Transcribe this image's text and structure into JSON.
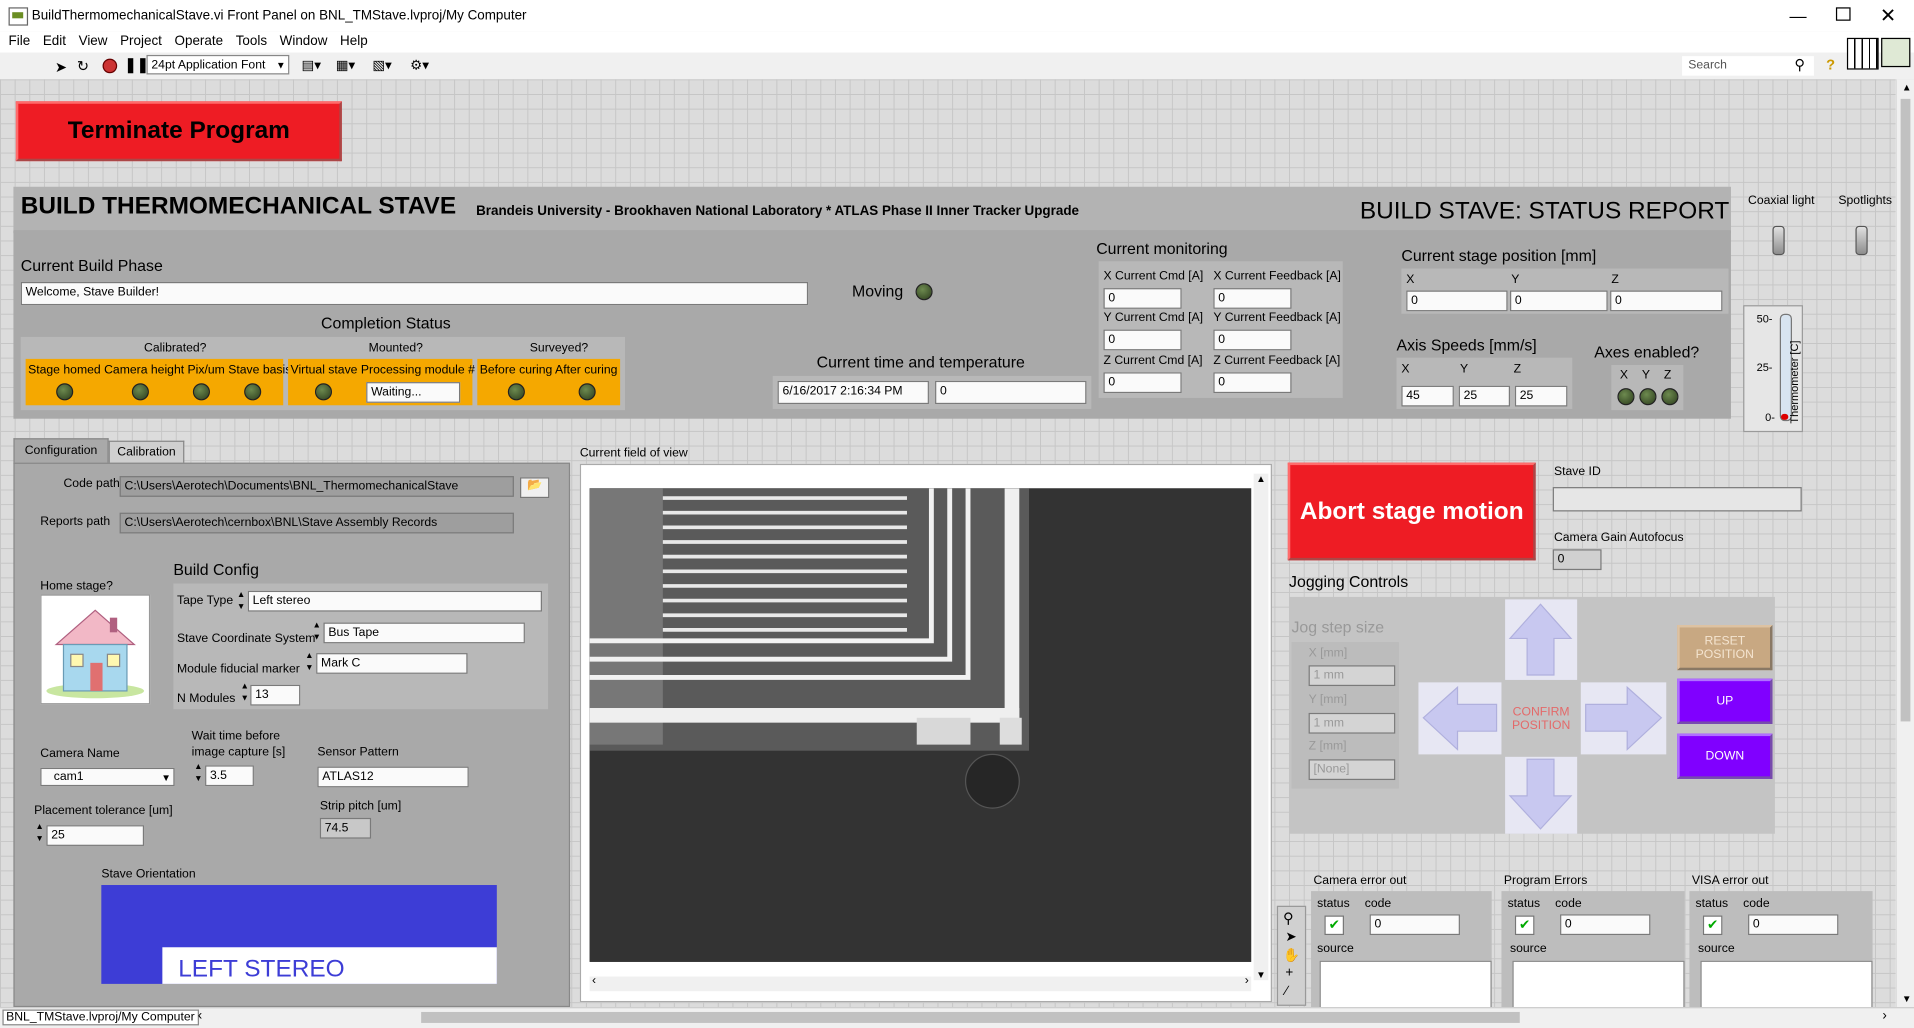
{
  "window": {
    "title": "BuildThermomechanicalStave.vi Front Panel on BNL_TMStave.lvproj/My Computer"
  },
  "menu": [
    "File",
    "Edit",
    "View",
    "Project",
    "Operate",
    "Tools",
    "Window",
    "Help"
  ],
  "toolbar": {
    "font": "24pt Application Font",
    "search_placeholder": "Search"
  },
  "terminate_label": "Terminate Program",
  "header": {
    "title": "BUILD THERMOMECHANICAL STAVE",
    "subtitle": "Brandeis University - Brookhaven National Laboratory * ATLAS Phase II Inner Tracker Upgrade",
    "status": "BUILD STAVE: STATUS REPORT"
  },
  "lights": {
    "coaxial": "Coaxial light",
    "spotlights": "Spotlights"
  },
  "build_phase": {
    "label": "Current Build Phase",
    "value": "Welcome, Stave Builder!"
  },
  "moving": "Moving",
  "completion": {
    "title": "Completion Status",
    "groups": [
      {
        "header": "Calibrated?",
        "items": "Stage homed Camera height Pix/um Stave basis"
      },
      {
        "header": "Mounted?",
        "items": "Virtual stave Processing module #",
        "value": "Waiting..."
      },
      {
        "header": "Surveyed?",
        "items": "Before curing After curing"
      }
    ]
  },
  "time_temp": {
    "label": "Current time and temperature",
    "time": "6/16/2017 2:16:34 PM",
    "temp": "0"
  },
  "monitoring": {
    "label": "Current monitoring",
    "x_cmd": "X Current Cmd [A]",
    "x_fb": "X Current Feedback [A]",
    "y_cmd": "Y Current Cmd [A]",
    "y_fb": "Y Current Feedback [A]",
    "z_cmd": "Z Current Cmd [A]",
    "z_fb": "Z Current Feedback [A]",
    "zero": "0"
  },
  "stage_pos": {
    "label": "Current stage position [mm]",
    "x": "X",
    "y": "Y",
    "z": "Z",
    "xv": "0",
    "yv": "0",
    "zv": "0"
  },
  "axis_speeds": {
    "label": "Axis Speeds [mm/s]",
    "x": "X",
    "y": "Y",
    "z": "Z",
    "xv": "45",
    "yv": "25",
    "zv": "25"
  },
  "axes_enabled": {
    "label": "Axes enabled?",
    "x": "X",
    "y": "Y",
    "z": "Z"
  },
  "thermometer": {
    "label": "Thermometer [C]",
    "t50": "50-",
    "t25": "25-",
    "t0": "0-"
  },
  "tabs": {
    "config": "Configuration",
    "calib": "Calibration"
  },
  "config": {
    "code_path_label": "Code path",
    "code_path": "C:\\Users\\Aerotech\\Documents\\BNL_ThermomechanicalStave",
    "reports_path_label": "Reports path",
    "reports_path": "C:\\Users\\Aerotech\\cernbox\\BNL\\Stave Assembly Records",
    "home_label": "Home stage?",
    "build_config": "Build Config",
    "tape_label": "Tape Type",
    "tape": "Left stereo",
    "coord_label": "Stave Coordinate System",
    "coord": "Bus Tape",
    "fid_label": "Module fiducial marker",
    "fid": "Mark C",
    "nmod_label": "N Modules",
    "nmod": "13",
    "cam_label": "Camera Name",
    "cam": "cam1",
    "wait_label1": "Wait time before",
    "wait_label2": "image capture [s]",
    "wait": "3.5",
    "sensor_label": "Sensor Pattern",
    "sensor": "ATLAS12",
    "tol_label": "Placement tolerance [um]",
    "tol": "25",
    "pitch_label": "Strip pitch [um]",
    "pitch": "74.5",
    "orient_label": "Stave Orientation",
    "orient": "LEFT STEREO"
  },
  "fov_label": "Current field of view",
  "abort_label": "Abort stage motion",
  "stave_id_label": "Stave ID",
  "gain_label": "Camera Gain Autofocus",
  "gain": "0",
  "jog": {
    "label": "Jogging Controls",
    "step": "Jog step size",
    "x_label": "X [mm]",
    "x": "1 mm",
    "y_label": "Y [mm]",
    "y": "1 mm",
    "z_label": "Z [mm]",
    "z": "[None]",
    "confirm": "CONFIRM POSITION",
    "reset": "RESET POSITION",
    "up": "UP",
    "down": "DOWN"
  },
  "errors": [
    {
      "title": "Camera error out",
      "status": "status",
      "code": "code",
      "code_val": "0",
      "source": "source"
    },
    {
      "title": "Program Errors",
      "status": "status",
      "code": "code",
      "code_val": "0",
      "source": "source"
    },
    {
      "title": "VISA error out",
      "status": "status",
      "code": "code",
      "code_val": "0",
      "source": "source"
    }
  ],
  "statusbar": "BNL_TMStave.lvproj/My Computer",
  "colors": {
    "red": "#ee1c24",
    "orange": "#f5a800",
    "purple": "#8000ff",
    "blue": "#3d3dd6"
  }
}
